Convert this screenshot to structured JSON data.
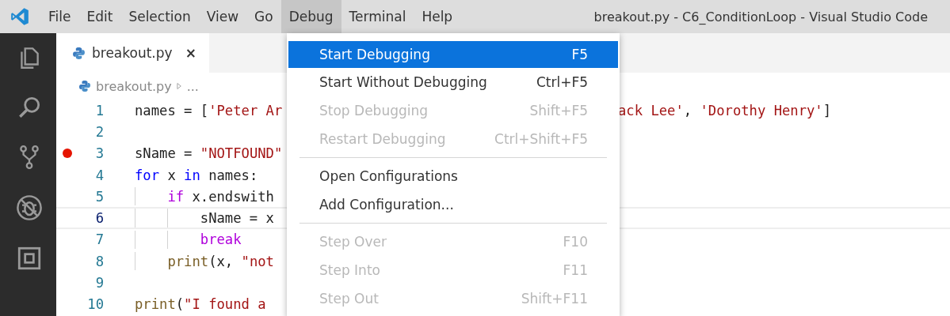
{
  "window": {
    "title": "breakout.py - C6_ConditionLoop - Visual Studio Code"
  },
  "menubar": [
    {
      "label": "File",
      "selected": false
    },
    {
      "label": "Edit",
      "selected": false
    },
    {
      "label": "Selection",
      "selected": false
    },
    {
      "label": "View",
      "selected": false
    },
    {
      "label": "Go",
      "selected": false
    },
    {
      "label": "Debug",
      "selected": true
    },
    {
      "label": "Terminal",
      "selected": false
    },
    {
      "label": "Help",
      "selected": false
    }
  ],
  "activity_bar": [
    {
      "kind": "files",
      "selected": false
    },
    {
      "kind": "search",
      "selected": false
    },
    {
      "kind": "scm",
      "selected": false
    },
    {
      "kind": "debug",
      "selected": false
    },
    {
      "kind": "extensions",
      "selected": false
    }
  ],
  "tabs": [
    {
      "label": "breakout.py",
      "selected": true,
      "close": "×"
    }
  ],
  "breadcrumb": {
    "file": "breakout.py",
    "rest": "..."
  },
  "editor": {
    "lines": [
      {
        "number": "1",
        "breakpoint": false,
        "current": false,
        "tokens": [
          {
            "kind": "plain",
            "text": "names = ["
          },
          {
            "kind": "string",
            "text": "'Peter Ar"
          }
        ],
        "tail": [
          {
            "kind": "string",
            "text": "ack Lee'"
          },
          {
            "kind": "plain",
            "text": ", "
          },
          {
            "kind": "string",
            "text": "'Dorothy Henry'"
          },
          {
            "kind": "plain",
            "text": "]"
          }
        ]
      },
      {
        "number": "2",
        "breakpoint": false,
        "current": false
      },
      {
        "number": "3",
        "breakpoint": true,
        "current": false,
        "tokens": [
          {
            "kind": "plain",
            "text": "sName = "
          },
          {
            "kind": "string",
            "text": "\"NOTFOUND\""
          }
        ]
      },
      {
        "number": "4",
        "breakpoint": false,
        "current": false,
        "tokens": [
          {
            "kind": "keyword",
            "text": "for"
          },
          {
            "kind": "plain",
            "text": " x "
          },
          {
            "kind": "keyword",
            "text": "in"
          },
          {
            "kind": "plain",
            "text": " names:"
          }
        ]
      },
      {
        "number": "5",
        "breakpoint": false,
        "current": false,
        "tokens": [
          {
            "kind": "control",
            "text": "    if"
          },
          {
            "kind": "plain",
            "text": " x.endswith"
          }
        ]
      },
      {
        "number": "6",
        "breakpoint": false,
        "current": true,
        "tokens": [
          {
            "kind": "plain",
            "text": "        sName = x"
          }
        ]
      },
      {
        "number": "7",
        "breakpoint": false,
        "current": false,
        "tokens": [
          {
            "kind": "control",
            "text": "        break"
          }
        ]
      },
      {
        "number": "8",
        "breakpoint": false,
        "current": false,
        "tokens": [
          {
            "kind": "function",
            "text": "    print"
          },
          {
            "kind": "plain",
            "text": "(x, "
          },
          {
            "kind": "string",
            "text": "\"not"
          }
        ]
      },
      {
        "number": "9",
        "breakpoint": false,
        "current": false
      },
      {
        "number": "10",
        "breakpoint": false,
        "current": false,
        "tokens": [
          {
            "kind": "function",
            "text": "print"
          },
          {
            "kind": "plain",
            "text": "("
          },
          {
            "kind": "string",
            "text": "\"I found a "
          }
        ]
      }
    ]
  },
  "debug_menu": {
    "groups": [
      [
        {
          "label": "Start Debugging",
          "shortcut": "F5",
          "selected": true,
          "disabled": false
        },
        {
          "label": "Start Without Debugging",
          "shortcut": "Ctrl+F5",
          "selected": false,
          "disabled": false
        },
        {
          "label": "Stop Debugging",
          "shortcut": "Shift+F5",
          "selected": false,
          "disabled": true
        },
        {
          "label": "Restart Debugging",
          "shortcut": "Ctrl+Shift+F5",
          "selected": false,
          "disabled": true
        }
      ],
      [
        {
          "label": "Open Configurations",
          "selected": false,
          "disabled": false
        },
        {
          "label": "Add Configuration...",
          "selected": false,
          "disabled": false
        }
      ],
      [
        {
          "label": "Step Over",
          "shortcut": "F10",
          "selected": false,
          "disabled": true
        },
        {
          "label": "Step Into",
          "shortcut": "F11",
          "selected": false,
          "disabled": true
        },
        {
          "label": "Step Out",
          "shortcut": "Shift+F11",
          "selected": false,
          "disabled": true
        }
      ]
    ]
  }
}
